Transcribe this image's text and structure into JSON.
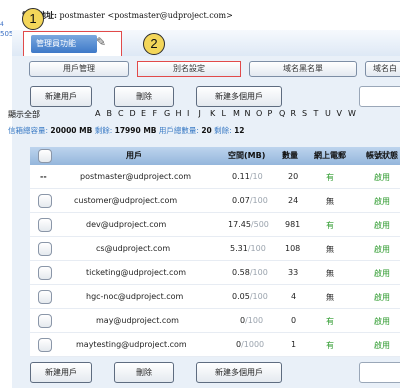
{
  "header": {
    "mail_label": "電郵地址:",
    "mail_value": "postmaster <postmaster@udproject.com>",
    "left_code": "505",
    "left_code_top": "4"
  },
  "badges": [
    "1",
    "2"
  ],
  "main_tab": {
    "label": "管理員功能",
    "icon": "admin-tools-icon"
  },
  "sub_tabs": [
    "用戶管理",
    "別名設定",
    "域名黑名單",
    "域名白"
  ],
  "actions": {
    "new_user": "新建用戶",
    "delete": "刪除",
    "new_multi": "新建多個用戶"
  },
  "alphabet": {
    "all": "顯示全部",
    "letters": [
      "A",
      "B",
      "C",
      "D",
      "E",
      "F",
      "G",
      "H",
      "I",
      "J",
      "K",
      "L",
      "M",
      "N",
      "O",
      "P",
      "Q",
      "R",
      "S",
      "T",
      "U",
      "V",
      "W"
    ]
  },
  "quota": {
    "total_label": "信箱總容量:",
    "total_value": "20000 MB",
    "remain_label": "剩餘:",
    "remain_value": "17990 MB",
    "users_label": "用戶總數量:",
    "users_value": "20",
    "users_remain_label": "剩餘:",
    "users_remain_value": "12"
  },
  "table": {
    "headers": [
      "用戶",
      "空間(MB)",
      "數量",
      "網上電郵",
      "帳號狀態"
    ],
    "rows": [
      {
        "first": "--",
        "user": "postmaster@udproject.com",
        "used": "0.11",
        "total": "/10",
        "count": "20",
        "webmail": "有",
        "status": "啟用"
      },
      {
        "first": "",
        "user": "customer@udproject.com",
        "used": "0.07",
        "total": "/100",
        "count": "24",
        "webmail": "無",
        "status": "啟用"
      },
      {
        "first": "",
        "user": "dev@udproject.com",
        "used": "17.45",
        "total": "/500",
        "count": "981",
        "webmail": "有",
        "status": "啟用"
      },
      {
        "first": "",
        "user": "cs@udproject.com",
        "used": "5.31",
        "total": "/100",
        "count": "108",
        "webmail": "無",
        "status": "啟用"
      },
      {
        "first": "",
        "user": "ticketing@udproject.com",
        "used": "0.58",
        "total": "/100",
        "count": "33",
        "webmail": "無",
        "status": "啟用"
      },
      {
        "first": "",
        "user": "hgc-noc@udproject.com",
        "used": "0.05",
        "total": "/100",
        "count": "4",
        "webmail": "無",
        "status": "啟用"
      },
      {
        "first": "",
        "user": "may@udproject.com",
        "used": "0",
        "total": "/100",
        "count": "0",
        "webmail": "有",
        "status": "啟用"
      },
      {
        "first": "",
        "user": "maytesting@udproject.com",
        "used": "0",
        "total": "/1000",
        "count": "1",
        "webmail": "有",
        "status": "啟用"
      }
    ]
  },
  "colors": {
    "accent": "#3e79c8",
    "highlight": "#e14a4a",
    "green": "#2c9a2c",
    "panel": "#e9f0f8"
  }
}
